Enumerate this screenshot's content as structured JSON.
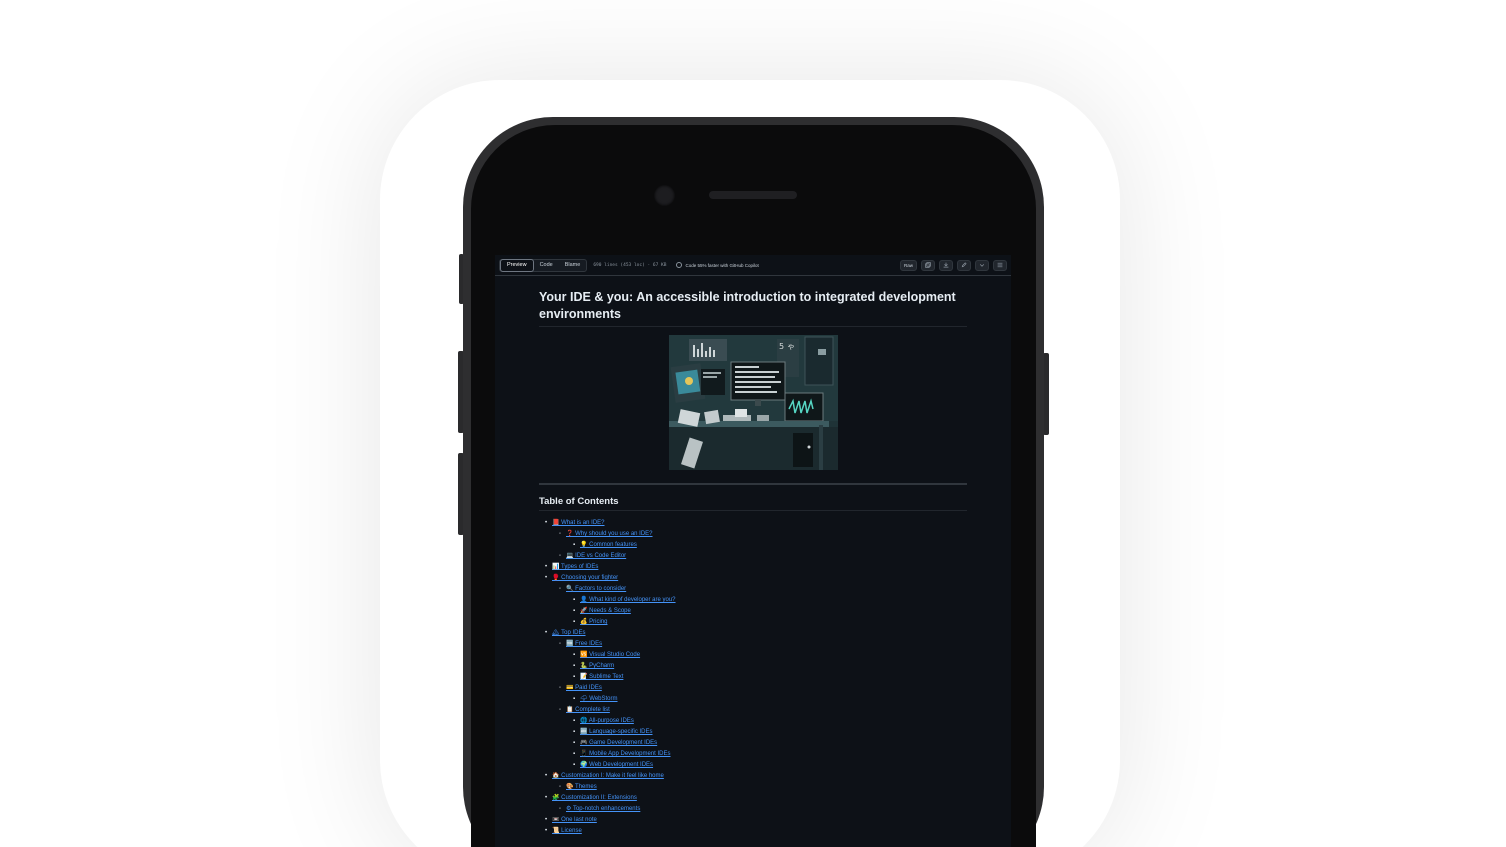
{
  "toolbar": {
    "tabs": [
      "Preview",
      "Code",
      "Blame"
    ],
    "active_tab": "Preview",
    "file_meta": "690 lines (453 loc) · 67 KB",
    "copilot_text": "Code 55% faster with GitHub Copilot",
    "raw_label": "Raw"
  },
  "readme": {
    "title": "Your IDE & you: An accessible introduction to integrated development environments",
    "toc_heading": "Table of Contents"
  },
  "toc": [
    {
      "level": 0,
      "text": "📕 What is an IDE?"
    },
    {
      "level": 1,
      "text": "❓ Why should you use an IDE?"
    },
    {
      "level": 2,
      "text": "💡 Common features"
    },
    {
      "level": 1,
      "text": "💻 IDE vs Code Editor"
    },
    {
      "level": 0,
      "text": "📊 Types of IDEs"
    },
    {
      "level": 0,
      "text": "🥊 Choosing your fighter"
    },
    {
      "level": 1,
      "text": "🔍 Factors to consider"
    },
    {
      "level": 2,
      "text": "👤 What kind of developer are you?"
    },
    {
      "level": 2,
      "text": "🚀 Needs & Scope"
    },
    {
      "level": 2,
      "text": "💰 Pricing"
    },
    {
      "level": 0,
      "text": "🏔 Top IDEs"
    },
    {
      "level": 1,
      "text": "🆓 Free IDEs"
    },
    {
      "level": 2,
      "text": "🆚 Visual Studio Code"
    },
    {
      "level": 2,
      "text": "🐍 PyCharm"
    },
    {
      "level": 2,
      "text": "📝 Sublime Text"
    },
    {
      "level": 1,
      "text": "💳 Paid IDEs"
    },
    {
      "level": 2,
      "text": "🌩 WebStorm"
    },
    {
      "level": 1,
      "text": "📋 Complete list"
    },
    {
      "level": 2,
      "text": "🌐 All-purpose IDEs"
    },
    {
      "level": 2,
      "text": "🔤 Language-specific IDEs"
    },
    {
      "level": 2,
      "text": "🎮 Game Development IDEs"
    },
    {
      "level": 2,
      "text": "📱 Mobile App Development IDEs"
    },
    {
      "level": 2,
      "text": "🌍 Web Development IDEs"
    },
    {
      "level": 0,
      "text": "🏠 Customization I: Make it feel like home"
    },
    {
      "level": 1,
      "text": "🎨 Themes"
    },
    {
      "level": 0,
      "text": "🧩 Customization II: Extensions"
    },
    {
      "level": 1,
      "text": "⚙ Top-notch enhancements"
    },
    {
      "level": 0,
      "text": "📼 One last note"
    },
    {
      "level": 0,
      "text": "📜 License"
    }
  ]
}
